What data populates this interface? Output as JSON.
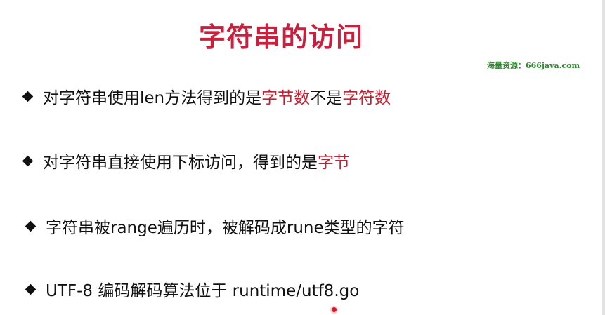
{
  "slide": {
    "title": "字符串的访问",
    "watermark": "海量资源：666java.com",
    "bullets": [
      {
        "parts": [
          {
            "text": "对字符串使用len方法得到的是",
            "emphasis": false
          },
          {
            "text": "字节数",
            "emphasis": true
          },
          {
            "text": "不是",
            "emphasis": false
          },
          {
            "text": "字符数",
            "emphasis": true
          }
        ]
      },
      {
        "parts": [
          {
            "text": "对字符串直接使用下标访问，得到的是",
            "emphasis": false
          },
          {
            "text": "字节",
            "emphasis": true
          }
        ]
      },
      {
        "parts": [
          {
            "text": "字符串被range遍历时，被解码成rune类型的字符",
            "emphasis": false
          }
        ]
      },
      {
        "parts": [
          {
            "text": "UTF-8 编码解码算法位于 runtime/utf8.go",
            "emphasis": false
          }
        ]
      }
    ],
    "colors": {
      "title": "#c9203e",
      "emphasis": "#c41f32",
      "watermark": "#2f8b2f",
      "text": "#111111"
    }
  }
}
